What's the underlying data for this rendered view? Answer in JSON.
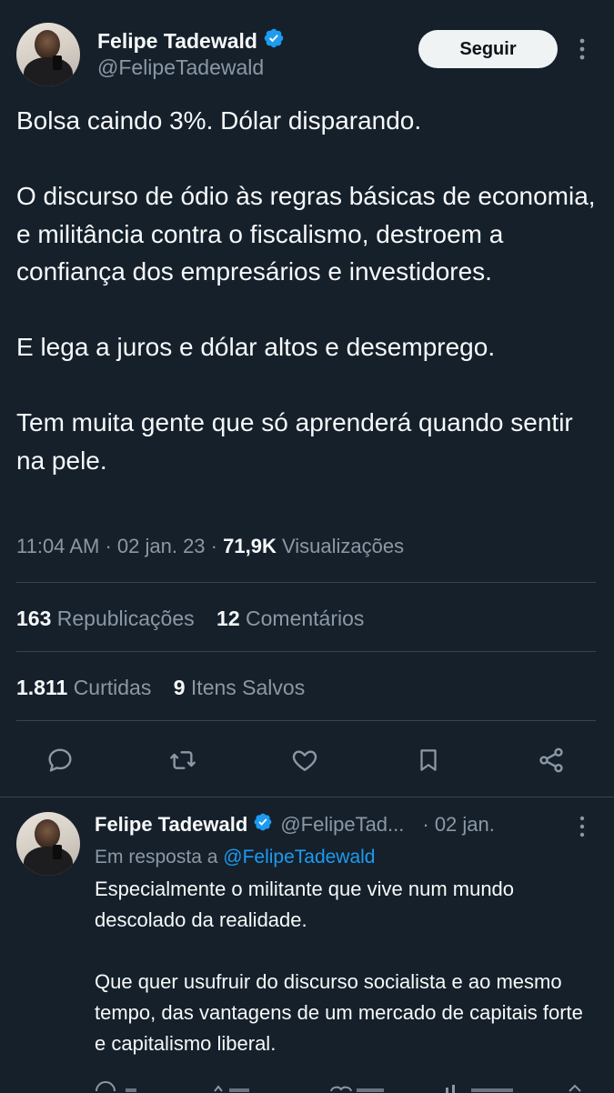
{
  "tweet": {
    "author_name": "Felipe Tadewald",
    "author_handle": "@FelipeTadewald",
    "follow_label": "Seguir",
    "paragraphs": [
      "Bolsa caindo 3%. Dólar disparando.",
      "O discurso de ódio às regras básicas de economia, e militância contra o fiscalismo, destroem a confiança dos empresários e investidores.",
      "E lega a juros e dólar altos e desemprego.",
      "Tem muita gente que só aprenderá quando sentir na pele."
    ],
    "time": "11:04 AM",
    "date": "02 jan. 23",
    "views_count": "71,9K",
    "views_label": "Visualizações",
    "reposts_count": "163",
    "reposts_label": "Republicações",
    "comments_count": "12",
    "comments_label": "Comentários",
    "likes_count": "1.811",
    "likes_label": "Curtidas",
    "saves_count": "9",
    "saves_label": "Itens Salvos"
  },
  "actions": {
    "icons": [
      "reply-icon",
      "retweet-icon",
      "like-icon",
      "bookmark-icon",
      "share-icon"
    ]
  },
  "reply": {
    "author_name": "Felipe Tadewald",
    "author_handle": "@FelipeTad...",
    "date": "· 02 jan.",
    "in_reply_prefix": "Em resposta a",
    "in_reply_handle": "@FelipeTadewald",
    "paragraphs": [
      "Especialmente o militante que vive num mundo descolado da realidade.",
      "Que quer usufruir do discurso socialista e ao mesmo tempo, das vantagens de um mercado de capitais forte e capitalismo liberal."
    ]
  },
  "colors": {
    "background": "#15202b",
    "text": "#f7f9f9",
    "muted": "#8b98a5",
    "accent": "#1d9bf0",
    "divider": "#38444d"
  }
}
